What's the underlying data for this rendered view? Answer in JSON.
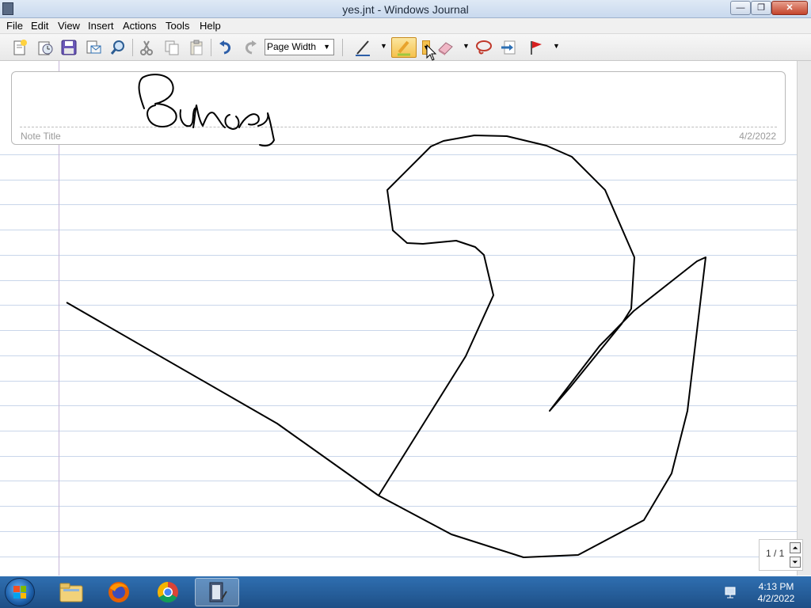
{
  "window": {
    "title": "yes.jnt - Windows Journal",
    "minimize_label": "—",
    "maximize_label": "❐",
    "close_label": "✕"
  },
  "menu": {
    "items": [
      "File",
      "Edit",
      "View",
      "Insert",
      "Actions",
      "Tools",
      "Help"
    ]
  },
  "toolbar": {
    "zoom_value": "Page Width",
    "icons": [
      "new-note-icon",
      "open-icon",
      "save-icon",
      "email-icon",
      "find-icon",
      "cut-icon",
      "copy-icon",
      "paste-icon",
      "undo-icon",
      "redo-icon",
      "pen-icon",
      "highlighter-icon",
      "eraser-icon",
      "lasso-select-icon",
      "insert-space-icon",
      "flag-icon"
    ],
    "active_tool": "highlighter"
  },
  "note": {
    "title_placeholder": "Note Title",
    "date": "4/2/2022",
    "title_ink_word": "Bruce"
  },
  "pager": {
    "page_indicator": "1 / 1",
    "up_label": "⏶",
    "down_label": "⏷"
  },
  "taskbar": {
    "apps": [
      "Windows Explorer",
      "Firefox",
      "Google Chrome",
      "Windows Journal"
    ],
    "time": "4:13 PM",
    "date": "4/2/2022"
  },
  "colors": {
    "accent": "#1e4f86",
    "rule_line": "#c9d6ea",
    "margin_line": "#c7b6d8",
    "highlight_active": "#f5c14c"
  }
}
